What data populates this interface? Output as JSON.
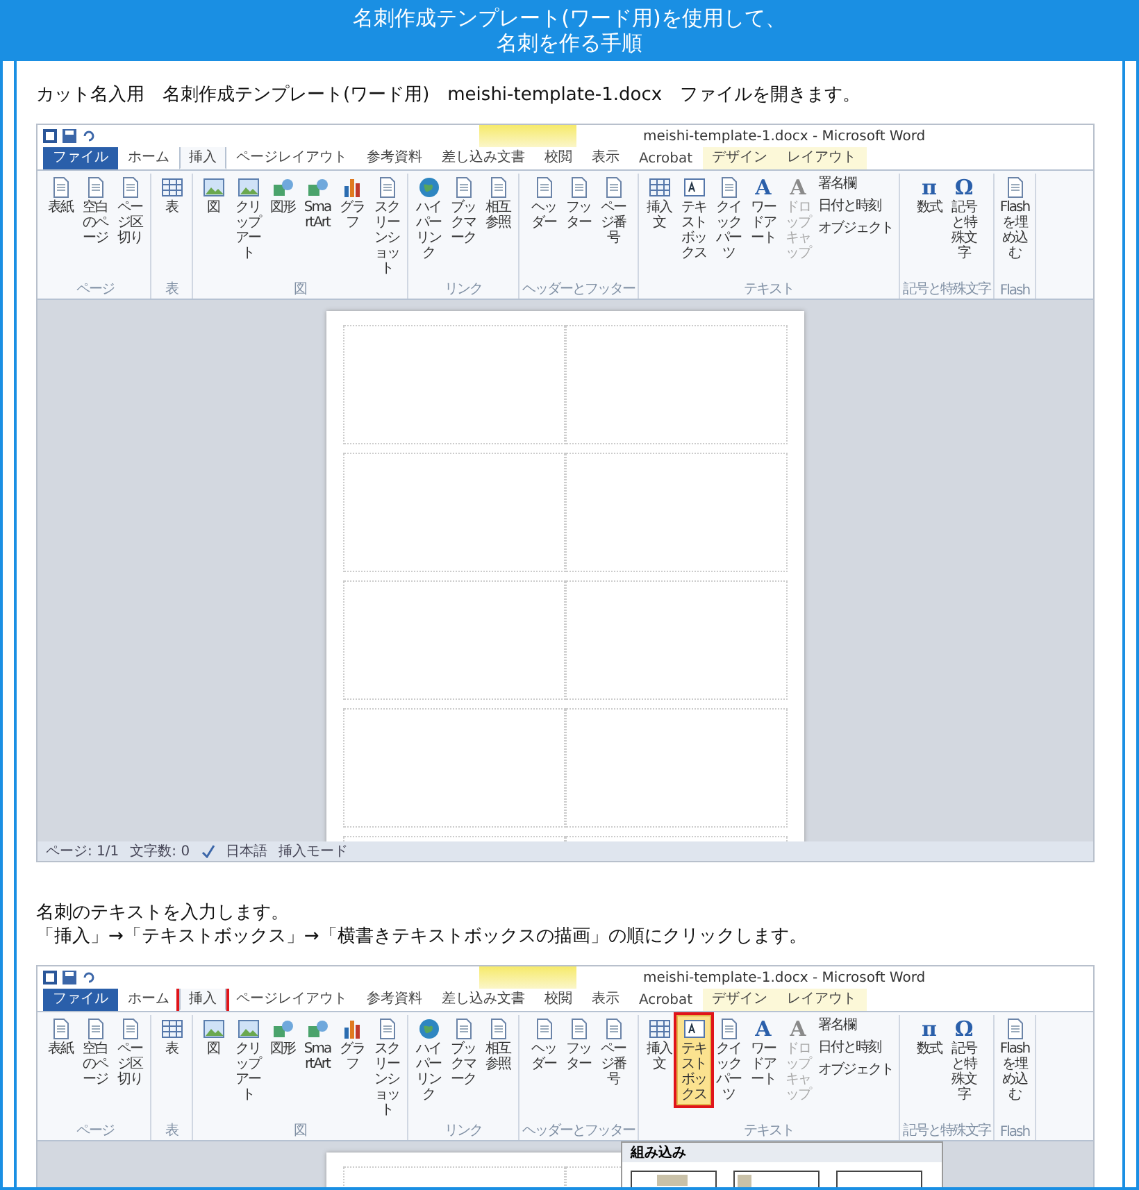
{
  "header": {
    "title_lines": [
      "名刺作成テンプレート(ワード用)を使用して、",
      "名刺を作る手順"
    ]
  },
  "steps": [
    {
      "text_lines": [
        "カット名入用　名刺作成テンプレート(ワード用)　meishi-template-1.docx　ファイルを開きます。"
      ],
      "screenshot": {
        "title": "meishi-template-1.docx - Microsoft Word",
        "tabs": [
          {
            "label": "ファイル",
            "kind": "file",
            "selected": false,
            "highlighted": false
          },
          {
            "label": "ホーム",
            "kind": "tab",
            "selected": false,
            "highlighted": false
          },
          {
            "label": "挿入",
            "kind": "tab",
            "selected": true,
            "highlighted": false
          },
          {
            "label": "ページレイアウト",
            "kind": "tab",
            "selected": false,
            "highlighted": false
          },
          {
            "label": "参考資料",
            "kind": "tab",
            "selected": false,
            "highlighted": false
          },
          {
            "label": "差し込み文書",
            "kind": "tab",
            "selected": false,
            "highlighted": false
          },
          {
            "label": "校閲",
            "kind": "tab",
            "selected": false,
            "highlighted": false
          },
          {
            "label": "表示",
            "kind": "tab",
            "selected": false,
            "highlighted": false
          },
          {
            "label": "Acrobat",
            "kind": "tab",
            "selected": false,
            "highlighted": false
          },
          {
            "label": "デザイン",
            "kind": "context",
            "selected": false,
            "highlighted": false
          },
          {
            "label": "レイアウト",
            "kind": "context",
            "selected": false,
            "highlighted": false
          }
        ],
        "groups": [
          {
            "label": "ページ",
            "buttons": [
              {
                "label": "表紙",
                "kind": "page",
                "disabled": false,
                "pressed": false,
                "highlighted": false
              },
              {
                "label": "空白のページ",
                "kind": "page",
                "disabled": false,
                "pressed": false,
                "highlighted": false
              },
              {
                "label": "ページ区切り",
                "kind": "page",
                "disabled": false,
                "pressed": false,
                "highlighted": false
              }
            ]
          },
          {
            "label": "表",
            "buttons": [
              {
                "label": "表",
                "kind": "table",
                "disabled": false,
                "pressed": false,
                "highlighted": false
              }
            ]
          },
          {
            "label": "図",
            "buttons": [
              {
                "label": "図",
                "kind": "picture",
                "disabled": false,
                "pressed": false,
                "highlighted": false
              },
              {
                "label": "クリップアート",
                "kind": "picture",
                "disabled": false,
                "pressed": false,
                "highlighted": false
              },
              {
                "label": "図形",
                "kind": "shapes",
                "disabled": false,
                "pressed": false,
                "highlighted": false
              },
              {
                "label": "SmartArt",
                "kind": "shapes",
                "disabled": false,
                "pressed": false,
                "highlighted": false
              },
              {
                "label": "グラフ",
                "kind": "chart",
                "disabled": false,
                "pressed": false,
                "highlighted": false
              },
              {
                "label": "スクリーンショット",
                "kind": "page",
                "disabled": false,
                "pressed": false,
                "highlighted": false
              }
            ]
          },
          {
            "label": "リンク",
            "buttons": [
              {
                "label": "ハイパーリンク",
                "kind": "globe",
                "disabled": false,
                "pressed": false,
                "highlighted": false
              },
              {
                "label": "ブックマーク",
                "kind": "page",
                "disabled": false,
                "pressed": false,
                "highlighted": false
              },
              {
                "label": "相互参照",
                "kind": "page",
                "disabled": false,
                "pressed": false,
                "highlighted": false
              }
            ]
          },
          {
            "label": "ヘッダーとフッター",
            "buttons": [
              {
                "label": "ヘッダー",
                "kind": "page",
                "disabled": false,
                "pressed": false,
                "highlighted": false
              },
              {
                "label": "フッター",
                "kind": "page",
                "disabled": false,
                "pressed": false,
                "highlighted": false
              },
              {
                "label": "ページ番号",
                "kind": "page",
                "disabled": false,
                "pressed": false,
                "highlighted": false
              }
            ]
          },
          {
            "label": "テキスト",
            "buttons": [
              {
                "label": "挿入文",
                "kind": "table",
                "disabled": false,
                "pressed": false,
                "highlighted": false
              },
              {
                "label": "テキストボックス",
                "kind": "textbox",
                "disabled": false,
                "pressed": false,
                "highlighted": false
              },
              {
                "label": "クイックパーツ",
                "kind": "page",
                "disabled": false,
                "pressed": false,
                "highlighted": false
              },
              {
                "label": "ワードアート",
                "kind": "glyph",
                "glyph": "A",
                "disabled": false,
                "pressed": false,
                "highlighted": false
              },
              {
                "label": "ドロップキャップ",
                "kind": "glyph",
                "glyph": "A",
                "disabled": true,
                "pressed": false,
                "highlighted": false
              }
            ],
            "small_buttons": [
              "署名欄",
              "日付と時刻",
              "オブジェクト"
            ]
          },
          {
            "label": "記号と特殊文字",
            "buttons": [
              {
                "label": "数式",
                "kind": "glyph",
                "glyph": "π",
                "disabled": false,
                "pressed": false,
                "highlighted": false
              },
              {
                "label": "記号と特殊文字",
                "kind": "glyph",
                "glyph": "Ω",
                "disabled": false,
                "pressed": false,
                "highlighted": false
              }
            ]
          },
          {
            "label": "Flash",
            "buttons": [
              {
                "label": "Flashを埋め込む",
                "kind": "page",
                "disabled": false,
                "pressed": false,
                "highlighted": false
              }
            ]
          }
        ],
        "status_bar": [
          "ページ: 1/1",
          "文字数: 0",
          "日本語",
          "挿入モード"
        ]
      }
    },
    {
      "text_lines": [
        "名刺のテキストを入力します。",
        "「挿入」→「テキストボックス」→「横書きテキストボックスの描画」の順にクリックします。"
      ],
      "screenshot": {
        "title": "meishi-template-1.docx - Microsoft Word",
        "tabs": [
          {
            "label": "ファイル",
            "kind": "file",
            "selected": false,
            "highlighted": false
          },
          {
            "label": "ホーム",
            "kind": "tab",
            "selected": false,
            "highlighted": false
          },
          {
            "label": "挿入",
            "kind": "tab",
            "selected": true,
            "highlighted": true
          },
          {
            "label": "ページレイアウト",
            "kind": "tab",
            "selected": false,
            "highlighted": false
          },
          {
            "label": "参考資料",
            "kind": "tab",
            "selected": false,
            "highlighted": false
          },
          {
            "label": "差し込み文書",
            "kind": "tab",
            "selected": false,
            "highlighted": false
          },
          {
            "label": "校閲",
            "kind": "tab",
            "selected": false,
            "highlighted": false
          },
          {
            "label": "表示",
            "kind": "tab",
            "selected": false,
            "highlighted": false
          },
          {
            "label": "Acrobat",
            "kind": "tab",
            "selected": false,
            "highlighted": false
          },
          {
            "label": "デザイン",
            "kind": "context",
            "selected": false,
            "highlighted": false
          },
          {
            "label": "レイアウト",
            "kind": "context",
            "selected": false,
            "highlighted": false
          }
        ],
        "groups": [
          {
            "label": "ページ",
            "buttons": [
              {
                "label": "表紙",
                "kind": "page",
                "disabled": false,
                "pressed": false,
                "highlighted": false
              },
              {
                "label": "空白のページ",
                "kind": "page",
                "disabled": false,
                "pressed": false,
                "highlighted": false
              },
              {
                "label": "ページ区切り",
                "kind": "page",
                "disabled": false,
                "pressed": false,
                "highlighted": false
              }
            ]
          },
          {
            "label": "表",
            "buttons": [
              {
                "label": "表",
                "kind": "table",
                "disabled": false,
                "pressed": false,
                "highlighted": false
              }
            ]
          },
          {
            "label": "図",
            "buttons": [
              {
                "label": "図",
                "kind": "picture",
                "disabled": false,
                "pressed": false,
                "highlighted": false
              },
              {
                "label": "クリップアート",
                "kind": "picture",
                "disabled": false,
                "pressed": false,
                "highlighted": false
              },
              {
                "label": "図形",
                "kind": "shapes",
                "disabled": false,
                "pressed": false,
                "highlighted": false
              },
              {
                "label": "SmartArt",
                "kind": "shapes",
                "disabled": false,
                "pressed": false,
                "highlighted": false
              },
              {
                "label": "グラフ",
                "kind": "chart",
                "disabled": false,
                "pressed": false,
                "highlighted": false
              },
              {
                "label": "スクリーンショット",
                "kind": "page",
                "disabled": false,
                "pressed": false,
                "highlighted": false
              }
            ]
          },
          {
            "label": "リンク",
            "buttons": [
              {
                "label": "ハイパーリンク",
                "kind": "globe",
                "disabled": false,
                "pressed": false,
                "highlighted": false
              },
              {
                "label": "ブックマーク",
                "kind": "page",
                "disabled": false,
                "pressed": false,
                "highlighted": false
              },
              {
                "label": "相互参照",
                "kind": "page",
                "disabled": false,
                "pressed": false,
                "highlighted": false
              }
            ]
          },
          {
            "label": "ヘッダーとフッター",
            "buttons": [
              {
                "label": "ヘッダー",
                "kind": "page",
                "disabled": false,
                "pressed": false,
                "highlighted": false
              },
              {
                "label": "フッター",
                "kind": "page",
                "disabled": false,
                "pressed": false,
                "highlighted": false
              },
              {
                "label": "ページ番号",
                "kind": "page",
                "disabled": false,
                "pressed": false,
                "highlighted": false
              }
            ]
          },
          {
            "label": "テキスト",
            "buttons": [
              {
                "label": "挿入文",
                "kind": "table",
                "disabled": false,
                "pressed": false,
                "highlighted": false
              },
              {
                "label": "テキストボックス",
                "kind": "textbox",
                "disabled": false,
                "pressed": true,
                "highlighted": true
              },
              {
                "label": "クイックパーツ",
                "kind": "page",
                "disabled": false,
                "pressed": false,
                "highlighted": false
              },
              {
                "label": "ワードアート",
                "kind": "glyph",
                "glyph": "A",
                "disabled": false,
                "pressed": false,
                "highlighted": false
              },
              {
                "label": "ドロップキャップ",
                "kind": "glyph",
                "glyph": "A",
                "disabled": true,
                "pressed": false,
                "highlighted": false
              }
            ],
            "small_buttons": [
              "署名欄",
              "日付と時刻",
              "オブジェクト"
            ]
          },
          {
            "label": "記号と特殊文字",
            "buttons": [
              {
                "label": "数式",
                "kind": "glyph",
                "glyph": "π",
                "disabled": false,
                "pressed": false,
                "highlighted": false
              },
              {
                "label": "記号と特殊文字",
                "kind": "glyph",
                "glyph": "Ω",
                "disabled": false,
                "pressed": false,
                "highlighted": false
              }
            ]
          },
          {
            "label": "Flash",
            "buttons": [
              {
                "label": "Flashを埋め込む",
                "kind": "page",
                "disabled": false,
                "pressed": false,
                "highlighted": false
              }
            ]
          }
        ],
        "gallery": {
          "title": "組み込み",
          "thumbnails": [
            {
              "kind": "top"
            },
            {
              "kind": "sidebar"
            },
            {
              "kind": "center"
            }
          ]
        }
      }
    }
  ]
}
